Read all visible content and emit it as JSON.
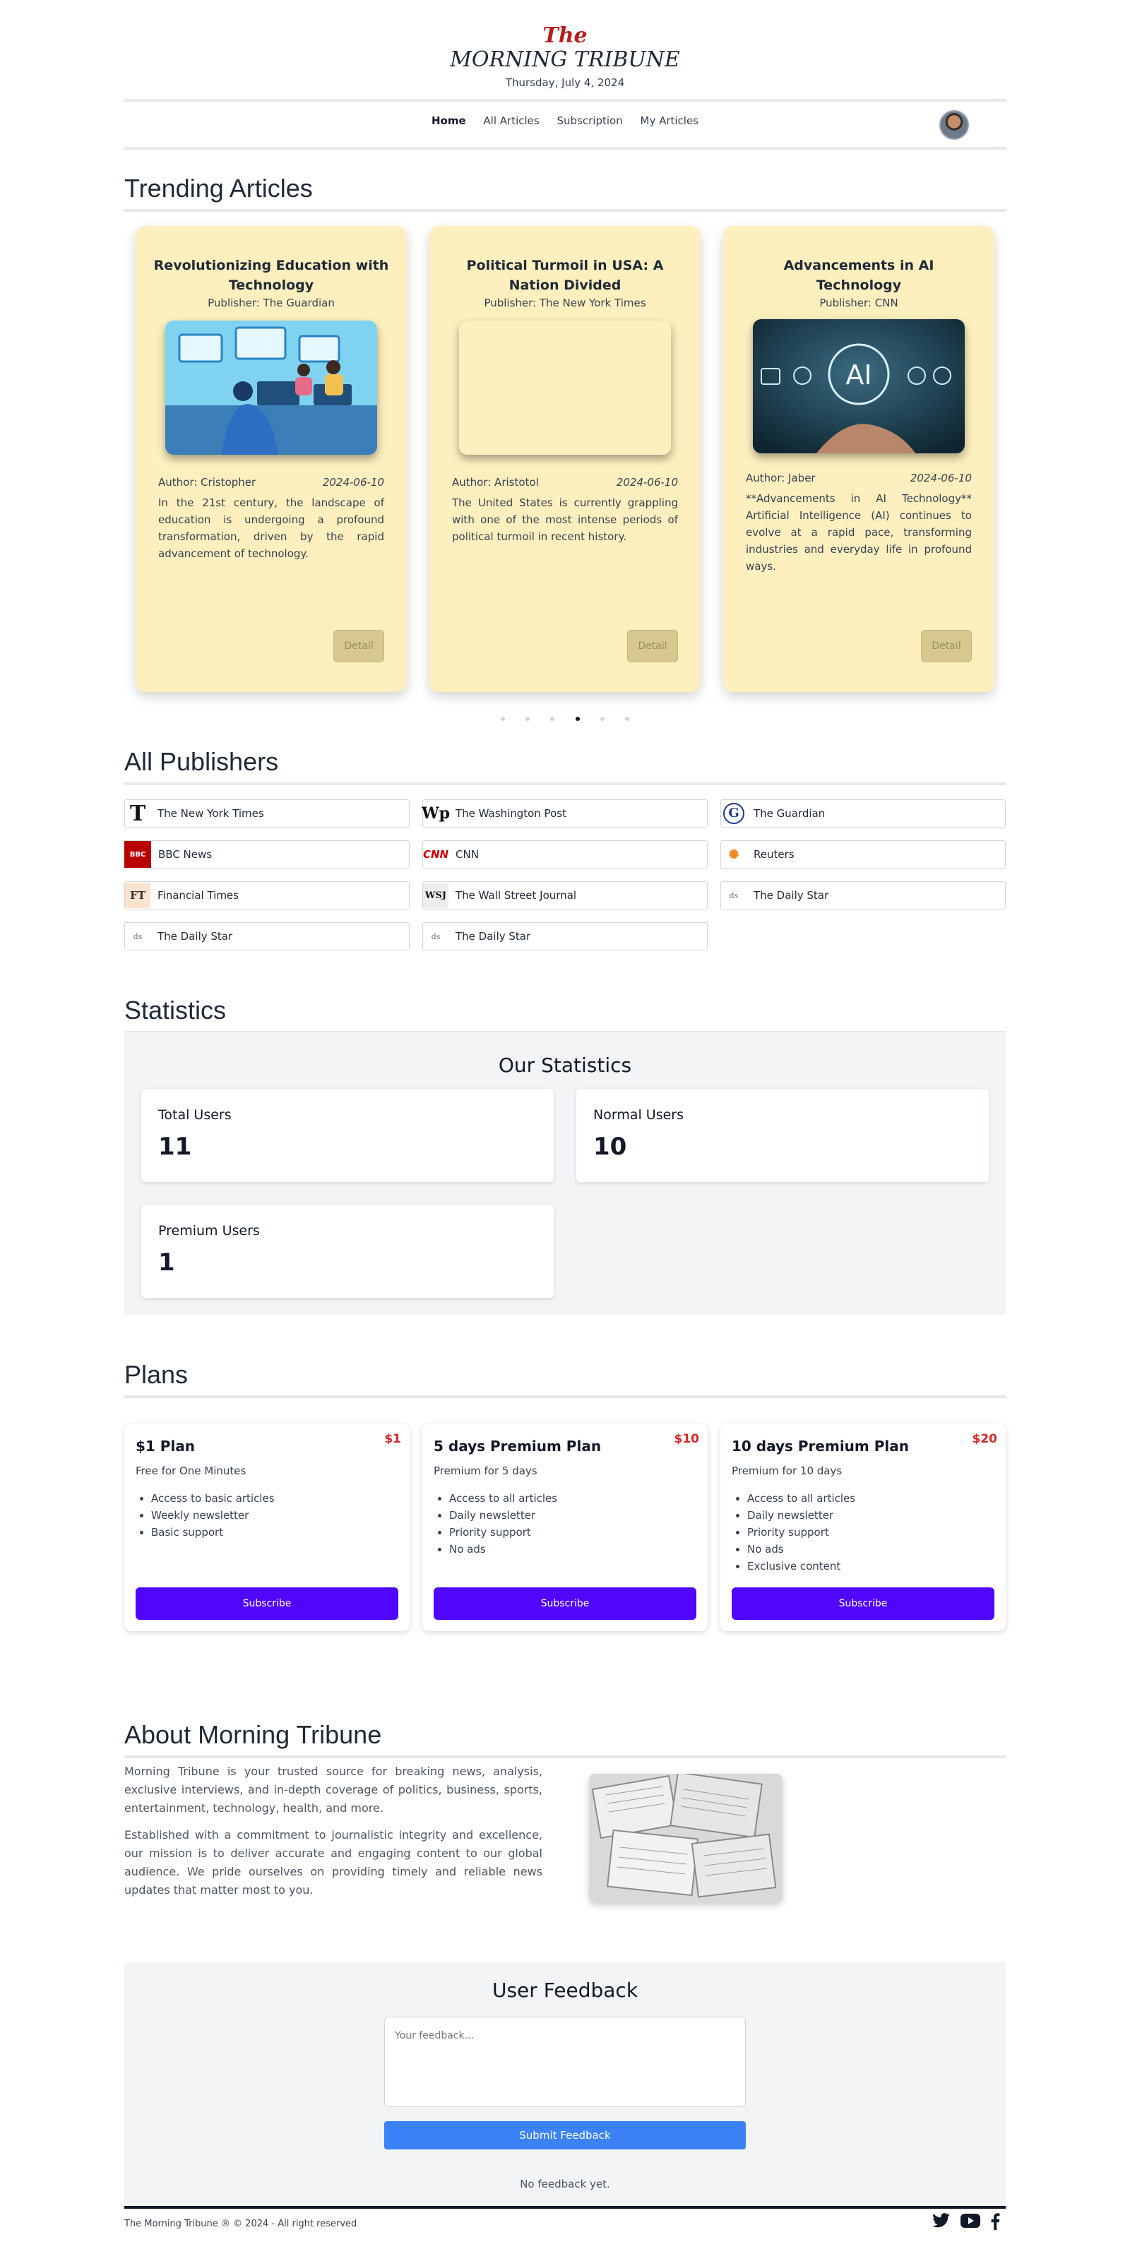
{
  "header": {
    "title_the": "The",
    "title_name": "MORNING TRIBUNE",
    "date": "Thursday, July 4, 2024"
  },
  "nav": {
    "items": [
      "Home",
      "All Articles",
      "Subscription",
      "My Articles"
    ],
    "active": "Home"
  },
  "trending": {
    "title": "Trending Articles",
    "cards": [
      {
        "title": "Revolutionizing Education with Technology",
        "publisher": "Publisher: The Guardian",
        "author": "Author: Cristopher",
        "date": "2024-06-10",
        "excerpt": "In the 21st century, the landscape of education is undergoing a profound transformation, driven by the rapid advancement of technology.",
        "button": "Detail"
      },
      {
        "title": "Political Turmoil in USA: A Nation Divided",
        "publisher": "Publisher: The New York Times",
        "author": "Author: Aristotol",
        "date": "2024-06-10",
        "excerpt": "The United States is currently grappling with one of the most intense periods of political turmoil in recent history.",
        "button": "Detail"
      },
      {
        "title": "Advancements in AI Technology",
        "publisher": "Publisher: CNN",
        "author": "Author: Jaber",
        "date": "2024-06-10",
        "excerpt": "**Advancements in AI Technology** Artificial Intelligence (AI) continues to evolve at a rapid pace, transforming industries and everyday life in profound ways.",
        "button": "Detail",
        "image_label": "AI"
      }
    ],
    "active_dot": 4
  },
  "publishers": {
    "title": "All Publishers",
    "items": [
      {
        "name": "The New York Times",
        "logo": "T",
        "logo_name": "nyt-logo"
      },
      {
        "name": "The Washington Post",
        "logo": "Wp",
        "logo_name": "washington-post-logo"
      },
      {
        "name": "The Guardian",
        "logo": "G",
        "logo_name": "guardian-logo"
      },
      {
        "name": "BBC News",
        "logo": "BBC",
        "logo_name": "bbc-logo"
      },
      {
        "name": "CNN",
        "logo": "CNN",
        "logo_name": "cnn-logo"
      },
      {
        "name": "Reuters",
        "logo": "✺",
        "logo_name": "reuters-logo"
      },
      {
        "name": "Financial Times",
        "logo": "FT",
        "logo_name": "ft-logo"
      },
      {
        "name": "The Wall Street Journal",
        "logo": "WSJ",
        "logo_name": "wsj-logo"
      },
      {
        "name": "The Daily Star",
        "logo": "ds",
        "logo_name": "daily-star-logo"
      },
      {
        "name": "The Daily Star",
        "logo": "ds",
        "logo_name": "daily-star-logo"
      },
      {
        "name": "The Daily Star",
        "logo": "ds",
        "logo_name": "daily-star-logo"
      }
    ]
  },
  "statistics": {
    "title": "Statistics",
    "heading": "Our Statistics",
    "total_label": "Total Users",
    "total_value": "11",
    "normal_label": "Normal Users",
    "normal_value": "10",
    "premium_label": "Premium Users",
    "premium_value": "1"
  },
  "plans": {
    "title": "Plans",
    "items": [
      {
        "price": "$1",
        "name": "$1 Plan",
        "desc": "Free for One Minutes",
        "features": [
          "Access to basic articles",
          "Weekly newsletter",
          "Basic support"
        ],
        "button": "Subscribe"
      },
      {
        "price": "$10",
        "name": "5 days Premium Plan",
        "desc": "Premium for 5 days",
        "features": [
          "Access to all articles",
          "Daily newsletter",
          "Priority support",
          "No ads"
        ],
        "button": "Subscribe"
      },
      {
        "price": "$20",
        "name": "10 days Premium Plan",
        "desc": "Premium for 10 days",
        "features": [
          "Access to all articles",
          "Daily newsletter",
          "Priority support",
          "No ads",
          "Exclusive content"
        ],
        "button": "Subscribe"
      }
    ]
  },
  "about": {
    "title": "About Morning Tribune",
    "p1": "Morning Tribune is your trusted source for breaking news, analysis, exclusive interviews, and in-depth coverage of politics, business, sports, entertainment, technology, health, and more.",
    "p2": "Established with a commitment to journalistic integrity and excellence, our mission is to deliver accurate and engaging content to our global audience. We pride ourselves on providing timely and reliable news updates that matter most to you."
  },
  "feedback": {
    "title": "User Feedback",
    "placeholder": "Your feedback...",
    "button": "Submit Feedback",
    "empty": "No feedback yet."
  },
  "footer": {
    "text": "The Morning Tribune ® © 2024 - All right reserved",
    "social": [
      "twitter-icon",
      "youtube-icon",
      "facebook-icon"
    ]
  },
  "colors": {
    "brand_red": "#b91c1c",
    "card_bg": "#fdefbe",
    "subscribe_bg": "#4f06fb",
    "feedback_button": "#3b82f6",
    "price_red": "#dc2626"
  }
}
